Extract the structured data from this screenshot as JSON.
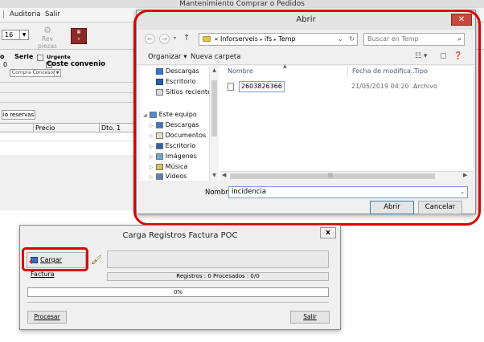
{
  "background_app": {
    "title": "Mantenimiento Comprar o Pedidos",
    "menu": [
      "Auditoria",
      "Salir"
    ],
    "combo_value": "16",
    "toolbar_label": "Rev piezas",
    "serie_label": "Serie",
    "urgente_label": "Urgente",
    "coste_convenio_label": "Coste convenio",
    "letter_o": "o",
    "digit_0": "0",
    "combo_option": "Compra Concesor",
    "reservas_button": "io reservas",
    "grid_columns": [
      "Precio",
      "Dto. 1"
    ]
  },
  "abrir_dialog": {
    "title": "Abrir",
    "breadcrumb": [
      "«",
      "Inforserveis",
      "ifs",
      "Temp"
    ],
    "search_placeholder": "Buscar en Temp",
    "toolbar": {
      "organizar": "Organizar ▾",
      "nueva_carpeta": "Nueva carpeta"
    },
    "nav_items": [
      {
        "label": "Descargas",
        "level": 1
      },
      {
        "label": "Escritorio",
        "level": 1
      },
      {
        "label": "Sitios recientes",
        "level": 1
      },
      {
        "label": "Este equipo",
        "level": 0
      },
      {
        "label": "Descargas",
        "level": 1
      },
      {
        "label": "Documentos",
        "level": 1
      },
      {
        "label": "Escritorio",
        "level": 1
      },
      {
        "label": "Imágenes",
        "level": 1
      },
      {
        "label": "Música",
        "level": 1
      },
      {
        "label": "Vídeos",
        "level": 1
      }
    ],
    "columns": {
      "name": "Nombre",
      "date": "Fecha de modifica...",
      "type": "Tipo"
    },
    "file": {
      "name": "2603826366",
      "date": "21/05/2019 04:20 ...",
      "type": "Archivo"
    },
    "filename_label": "Nombre:",
    "filename_value": "incidencia",
    "open_button": "Abrir",
    "cancel_button": "Cancelar"
  },
  "carga_dialog": {
    "title": "Carga Registros Factura POC",
    "close": "x",
    "cargar_button": "Cargar Factura",
    "registros_text": "Registros : 0   Procesados : 0/0",
    "progress_text": "0%",
    "progress": 0,
    "procesar_button": "Procesar",
    "salir_button": "Salir"
  },
  "colors": {
    "highlight": "#e00000",
    "close_red": "#c74a3c"
  }
}
